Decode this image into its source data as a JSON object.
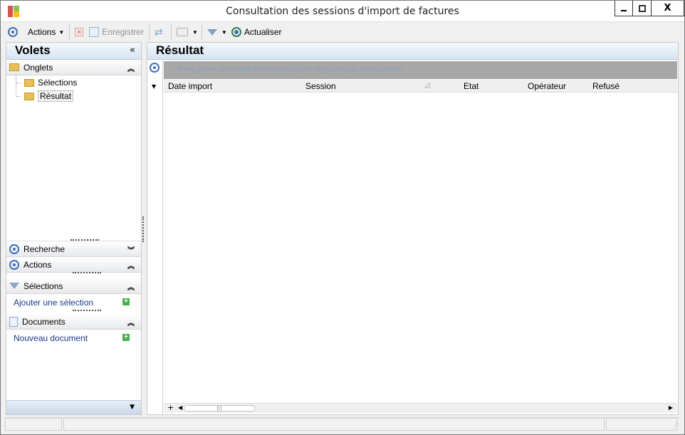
{
  "window": {
    "title": "Consultation des sessions d'import de factures",
    "controls": {
      "minimize": "—",
      "maximize": "▢",
      "close": "X"
    }
  },
  "toolbar": {
    "actions_label": "Actions",
    "save_label": "Enregistrer",
    "refresh_label": "Actualiser"
  },
  "left_panel": {
    "title": "Volets",
    "collapse_glyph": "«",
    "tabs_section": {
      "label": "Onglets",
      "chevron": "⌃",
      "items": [
        {
          "label": "Sélections",
          "selected": false
        },
        {
          "label": "Résultat",
          "selected": true
        }
      ]
    },
    "sections": [
      {
        "label": "Recherche",
        "chevron": "⌄"
      },
      {
        "label": "Actions",
        "chevron": "⌃"
      },
      {
        "label": "Sélections",
        "chevron": "⌃",
        "link": "Ajouter une sélection"
      },
      {
        "label": "Documents",
        "chevron": "⌃",
        "link": "Nouveau document"
      }
    ]
  },
  "result_panel": {
    "title": "Résultat",
    "group_hint": "Faire glisser un en-tête de colonne ici pour regrouper par cette colonne",
    "columns": [
      "Date import",
      "Session",
      "Etat",
      "Opérateur",
      "Refusé"
    ]
  },
  "colors": {
    "accent": "#3d6fb6",
    "header_gradient_top": "#f4f8fc",
    "header_gradient_bottom": "#d7e4f2",
    "link": "#1a3a8a",
    "group_band": "#a7a7a7"
  }
}
